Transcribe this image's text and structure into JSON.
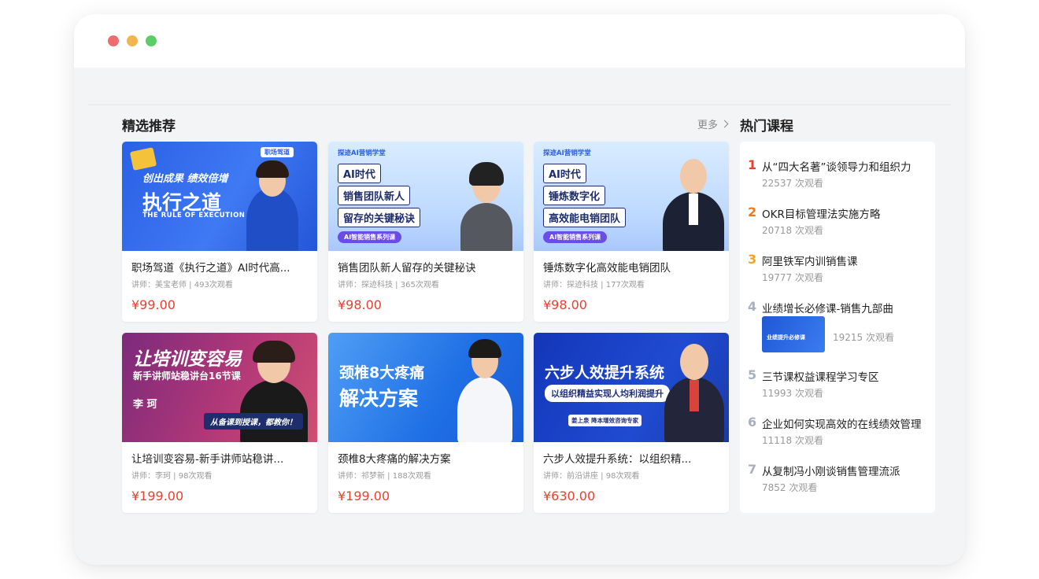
{
  "featured": {
    "title": "精选推荐",
    "more_label": "更多",
    "courses": [
      {
        "title": "职场驾道《执行之道》AI时代高...",
        "meta": "讲师：美宝老师 | 493次观看",
        "price": "¥99.00",
        "thumb": {
          "brand": "职场驾道",
          "slogan": "创出成果 绩效倍增",
          "headline": "执行之道",
          "subtitle": "THE RULE OF EXECUTION"
        }
      },
      {
        "title": "销售团队新人留存的关键秘诀",
        "meta": "讲师：探迹科技 | 365次观看",
        "price": "¥98.00",
        "thumb": {
          "brand": "探迹AI营销学堂",
          "lines": [
            "AI时代",
            "销售团队新人",
            "留存的关键秘诀"
          ],
          "series": "AI智能销售系列课"
        }
      },
      {
        "title": "锤炼数字化高效能电销团队",
        "meta": "讲师：探迹科技 | 177次观看",
        "price": "¥98.00",
        "thumb": {
          "brand": "探迹AI营销学堂",
          "lines": [
            "AI时代",
            "锤炼数字化",
            "高效能电销团队"
          ],
          "series": "AI智能销售系列课"
        }
      },
      {
        "title": "让培训变容易-新手讲师站稳讲...",
        "meta": "讲师：李珂 | 98次观看",
        "price": "¥199.00",
        "thumb": {
          "headline": "让培训变容易",
          "subtitle": "新手讲师站稳讲台16节课",
          "name": "李 珂",
          "banner": "从备课到授课，都教你！"
        }
      },
      {
        "title": "颈椎8大疼痛的解决方案",
        "meta": "讲师：祁梦新 | 188次观看",
        "price": "¥199.00",
        "thumb": {
          "line1": "颈椎8大疼痛",
          "line2": "解决方案"
        }
      },
      {
        "title": "六步人效提升系统：以组织精...",
        "meta": "讲师：前沿讲座 | 98次观看",
        "price": "¥630.00",
        "thumb": {
          "headline": "六步人效提升系统",
          "subtitle": "以组织精益实现人均利润提升",
          "name": "姜上泉 降本增效咨询专家"
        }
      }
    ]
  },
  "hot": {
    "title": "热门课程",
    "items": [
      {
        "rank": "1",
        "title": "从“四大名著”谈领导力和组织力",
        "views": "22537 次观看",
        "color": "#e8412f"
      },
      {
        "rank": "2",
        "title": "OKR目标管理法实施方略",
        "views": "20718 次观看",
        "color": "#f07a1a"
      },
      {
        "rank": "3",
        "title": "阿里铁军内训销售课",
        "views": "19777 次观看",
        "color": "#f4a21c"
      },
      {
        "rank": "4",
        "title": "业绩增长必修课-销售九部曲",
        "views": "19215 次观看",
        "color": "#a8b0bd",
        "thumb_text": "业绩提升必修课"
      },
      {
        "rank": "5",
        "title": "三节课权益课程学习专区",
        "views": "11993 次观看",
        "color": "#a8b0bd"
      },
      {
        "rank": "6",
        "title": "企业如何实现高效的在线绩效管理",
        "views": "11118 次观看",
        "color": "#a8b0bd"
      },
      {
        "rank": "7",
        "title": "从复制冯小刚谈销售管理流派",
        "views": "7852 次观看",
        "color": "#a8b0bd"
      }
    ]
  },
  "colors": {
    "price": "#e8412f",
    "accent_blue": "#2a60e6"
  }
}
